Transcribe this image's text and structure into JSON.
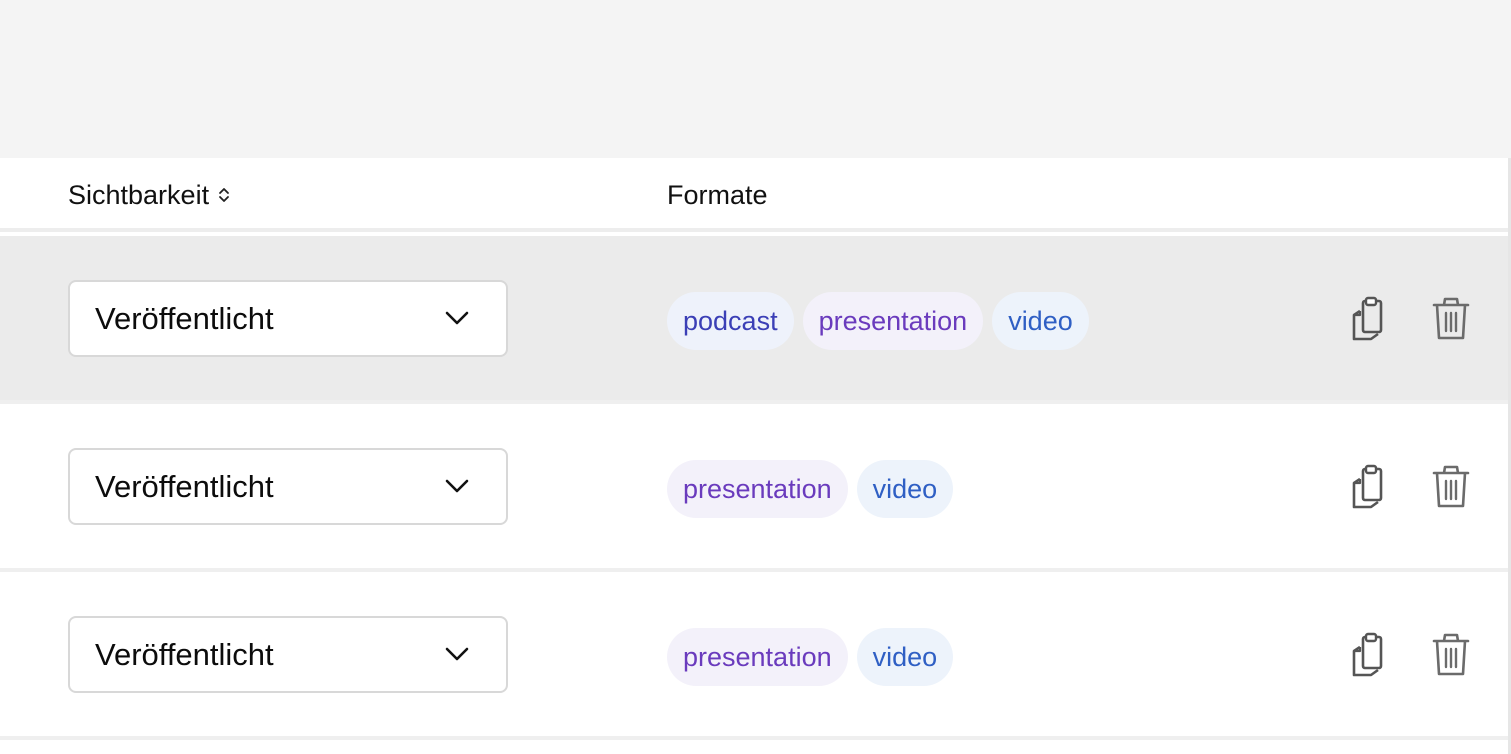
{
  "table": {
    "columns": {
      "visibility": "Sichtbarkeit",
      "formats": "Formate"
    },
    "rows": [
      {
        "visibility": "Veröffentlicht",
        "formats": [
          "podcast",
          "presentation",
          "video"
        ],
        "highlighted": true
      },
      {
        "visibility": "Veröffentlicht",
        "formats": [
          "presentation",
          "video"
        ],
        "highlighted": false
      },
      {
        "visibility": "Veröffentlicht",
        "formats": [
          "presentation",
          "video"
        ],
        "highlighted": false
      }
    ]
  },
  "icons": {
    "sort": "sort-updown-icon",
    "dropdown": "chevron-down-icon",
    "copy": "copy-icon",
    "delete": "trash-icon"
  },
  "colors": {
    "row_highlight": "#ebebeb",
    "tag_podcast_text": "#3b3fb6",
    "tag_presentation_text": "#6a3bbd",
    "tag_video_text": "#2f5fc4",
    "icon_gray": "#6b6b6b"
  }
}
